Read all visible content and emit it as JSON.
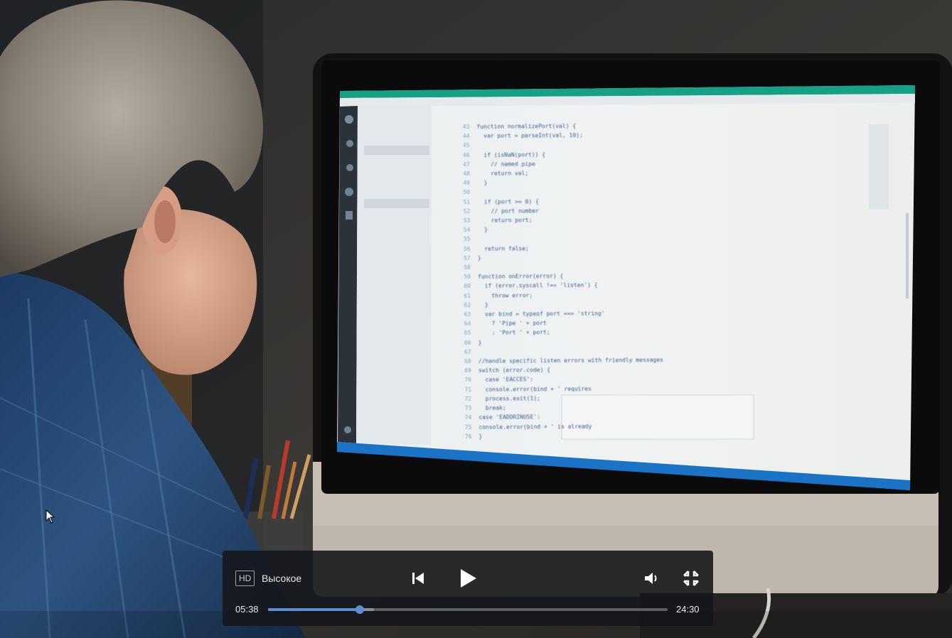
{
  "player": {
    "quality_badge": "HD",
    "quality_label": "Высокое",
    "current_time": "05:38",
    "duration": "24:30",
    "progress_fraction": 0.23,
    "buffered_fraction": 0.265,
    "accent_color": "#5b8fd1"
  },
  "icons": {
    "previous": "skip-previous-icon",
    "play": "play-icon",
    "volume": "volume-low-icon",
    "exit_fullscreen": "exit-fullscreen-icon"
  },
  "editor_code": [
    {
      "n": "43",
      "t": "function normalizePort(val) {"
    },
    {
      "n": "44",
      "t": "  var port = parseInt(val, 10);"
    },
    {
      "n": "45",
      "t": ""
    },
    {
      "n": "46",
      "t": "  if (isNaN(port)) {"
    },
    {
      "n": "47",
      "t": "    // named pipe"
    },
    {
      "n": "48",
      "t": "    return val;"
    },
    {
      "n": "49",
      "t": "  }"
    },
    {
      "n": "50",
      "t": ""
    },
    {
      "n": "51",
      "t": "  if (port >= 0) {"
    },
    {
      "n": "52",
      "t": "    // port number"
    },
    {
      "n": "53",
      "t": "    return port;"
    },
    {
      "n": "54",
      "t": "  }"
    },
    {
      "n": "55",
      "t": ""
    },
    {
      "n": "56",
      "t": "  return false;"
    },
    {
      "n": "57",
      "t": "}"
    },
    {
      "n": "58",
      "t": ""
    },
    {
      "n": "59",
      "t": "function onError(error) {"
    },
    {
      "n": "60",
      "t": "  if (error.syscall !== 'listen') {"
    },
    {
      "n": "61",
      "t": "    throw error;"
    },
    {
      "n": "62",
      "t": "  }"
    },
    {
      "n": "63",
      "t": "  var bind = typeof port === 'string'"
    },
    {
      "n": "64",
      "t": "    ? 'Pipe ' + port"
    },
    {
      "n": "65",
      "t": "    : 'Port ' + port;"
    },
    {
      "n": "66",
      "t": "}"
    },
    {
      "n": "67",
      "t": ""
    },
    {
      "n": "68",
      "t": "//handle specific listen errors with friendly messages"
    },
    {
      "n": "69",
      "t": "switch (error.code) {"
    },
    {
      "n": "70",
      "t": "  case 'EACCES':"
    },
    {
      "n": "71",
      "t": "  console.error(bind + ' requires"
    },
    {
      "n": "72",
      "t": "  process.exit(1);"
    },
    {
      "n": "73",
      "t": "  break;"
    },
    {
      "n": "74",
      "t": "case 'EADDRINUSE':"
    },
    {
      "n": "75",
      "t": "console.error(bind + ' is already"
    },
    {
      "n": "76",
      "t": "}"
    }
  ]
}
